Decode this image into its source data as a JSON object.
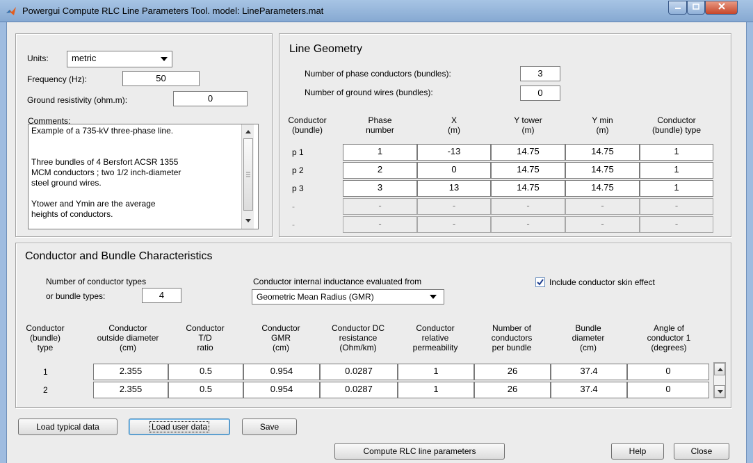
{
  "window": {
    "title": "Powergui Compute RLC Line Parameters Tool.  model: LineParameters.mat"
  },
  "general": {
    "units_label": "Units:",
    "units_value": "metric",
    "frequency_label": "Frequency (Hz):",
    "frequency_value": "50",
    "ground_label": "Ground resistivity (ohm.m):",
    "ground_value": "0",
    "comments_label": "Comments:",
    "comments_lines": [
      "Example of a 735-kV three-phase line.",
      "",
      "",
      "Three bundles of 4 Bersfort ACSR 1355",
      "MCM conductors ; two 1/2 inch-diameter",
      "steel ground wires.",
      "",
      "Ytower and Ymin are the average",
      "heights of conductors."
    ]
  },
  "geometry": {
    "title": "Line Geometry",
    "phase_label": "Number of phase conductors (bundles):",
    "phase_value": "3",
    "ground_label": "Number of ground wires (bundles):",
    "ground_value": "0",
    "headers": [
      [
        "Conductor",
        "(bundle)"
      ],
      [
        "Phase",
        "number"
      ],
      [
        "X",
        "(m)"
      ],
      [
        "Y tower",
        "(m)"
      ],
      [
        "Y min",
        "(m)"
      ],
      [
        "Conductor",
        "(bundle) type"
      ]
    ],
    "rows": [
      {
        "label": "p 1",
        "cells": [
          "1",
          "-13",
          "14.75",
          "14.75",
          "1"
        ]
      },
      {
        "label": "p 2",
        "cells": [
          "2",
          "0",
          "14.75",
          "14.75",
          "1"
        ]
      },
      {
        "label": "p 3",
        "cells": [
          "3",
          "13",
          "14.75",
          "14.75",
          "1"
        ]
      },
      {
        "label": "-",
        "cells": [
          "-",
          "-",
          "-",
          "-",
          "-"
        ]
      },
      {
        "label": "-",
        "cells": [
          "-",
          "-",
          "-",
          "-",
          "-"
        ]
      }
    ]
  },
  "conductor": {
    "title": "Conductor and Bundle Characteristics",
    "types_label_1": "Number of conductor types",
    "types_label_2": "or bundle types:",
    "types_value": "4",
    "inductance_label": "Conductor internal inductance evaluated from",
    "inductance_value": "Geometric Mean Radius (GMR)",
    "skin_label": "Include conductor skin effect",
    "headers": [
      [
        "Conductor",
        "(bundle)",
        "type"
      ],
      [
        "Conductor",
        "outside diameter",
        "(cm)"
      ],
      [
        "Conductor",
        "T/D",
        "ratio"
      ],
      [
        "Conductor",
        "GMR",
        "(cm)"
      ],
      [
        "Conductor DC",
        "resistance",
        "(Ohm/km)"
      ],
      [
        "Conductor",
        "relative",
        "permeability"
      ],
      [
        "Number of",
        "conductors",
        "per bundle"
      ],
      [
        "Bundle",
        "diameter",
        "(cm)"
      ],
      [
        "Angle of",
        "conductor 1",
        "(degrees)"
      ]
    ],
    "rows": [
      {
        "label": "1",
        "cells": [
          "2.355",
          "0.5",
          "0.954",
          "0.0287",
          "1",
          "26",
          "37.4",
          "0"
        ]
      },
      {
        "label": "2",
        "cells": [
          "2.355",
          "0.5",
          "0.954",
          "0.0287",
          "1",
          "26",
          "37.4",
          "0"
        ]
      }
    ]
  },
  "buttons": {
    "load_typical": "Load typical data",
    "load_user": "Load user data",
    "save": "Save",
    "compute": "Compute RLC line parameters",
    "help": "Help",
    "close": "Close"
  }
}
